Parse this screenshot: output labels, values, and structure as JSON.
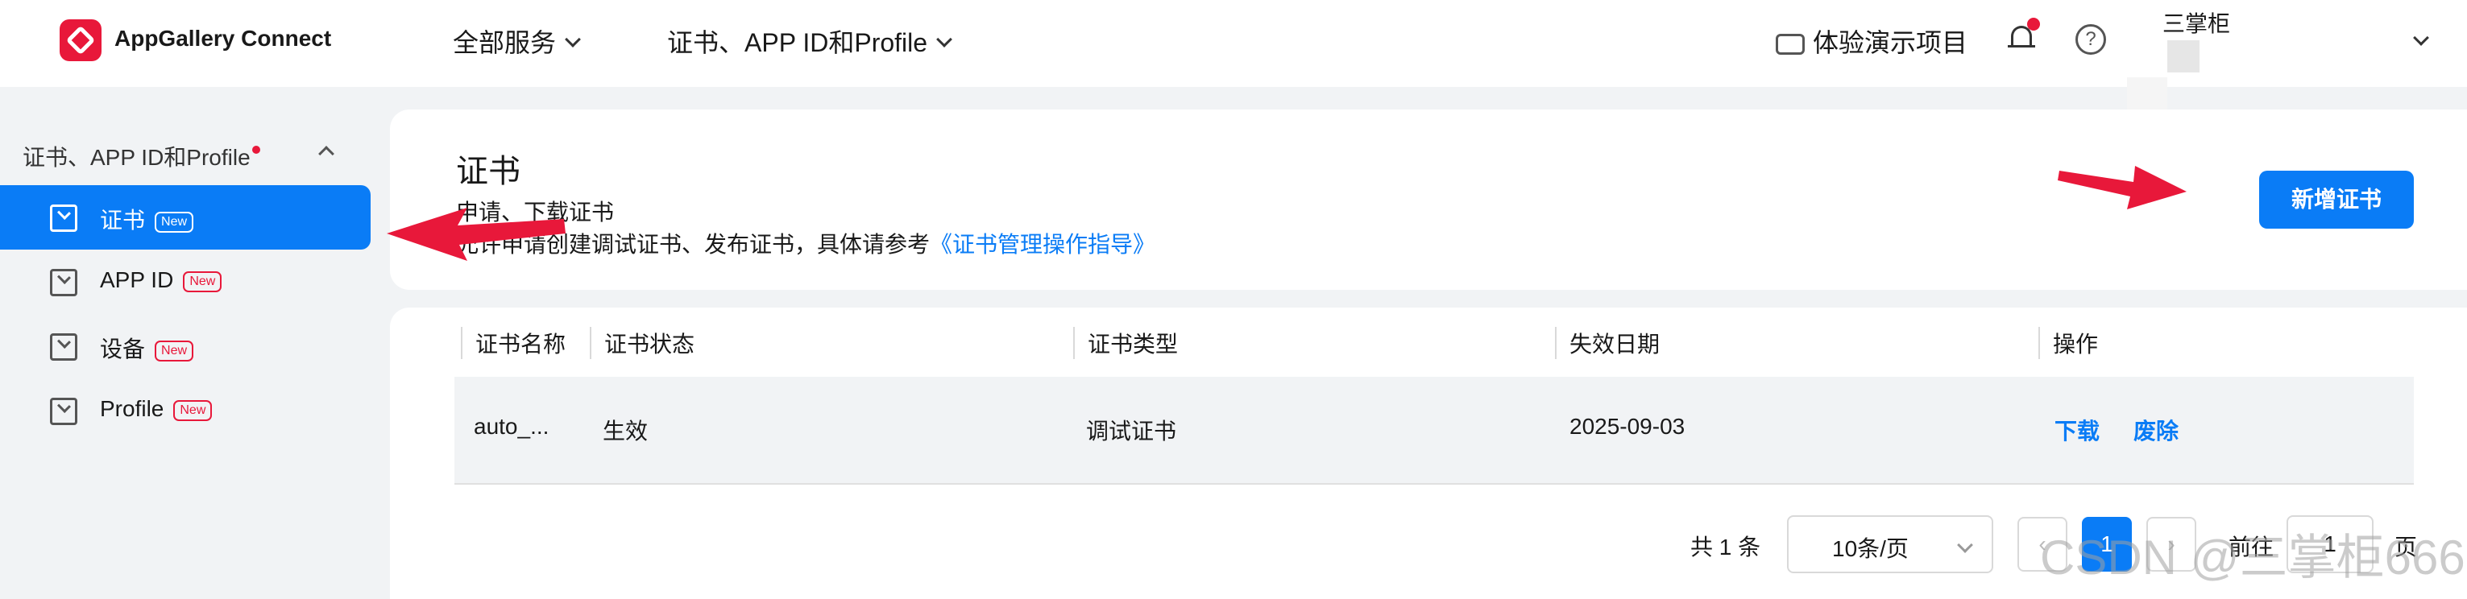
{
  "topbar": {
    "app_name": "AppGallery Connect",
    "nav": [
      "全部服务",
      "证书、APP ID和Profile"
    ],
    "demo_label": "体验演示项目",
    "help_glyph": "?",
    "username": "三掌柜"
  },
  "sidebar": {
    "group_label": "证书、APP ID和Profile",
    "items": [
      {
        "label": "证书",
        "badge": "New"
      },
      {
        "label": "APP ID",
        "badge": "New"
      },
      {
        "label": "设备",
        "badge": "New"
      },
      {
        "label": "Profile",
        "badge": "New"
      }
    ]
  },
  "header": {
    "title": "证书",
    "subtitle": "申请、下载证书",
    "description": "允许申请创建调试证书、发布证书，具体请参考",
    "guide_link": "《证书管理操作指导》",
    "add_button": "新增证书"
  },
  "table": {
    "columns": [
      "证书名称",
      "证书状态",
      "证书类型",
      "失效日期",
      "操作"
    ],
    "rows": [
      {
        "name": "auto_...",
        "status": "生效",
        "type": "调试证书",
        "expiry": "2025-09-03",
        "actions": [
          "下载",
          "废除"
        ]
      }
    ]
  },
  "pagination": {
    "total": "共 1 条",
    "page_size": "10条/页",
    "prev": "‹",
    "current": "1",
    "next": "›",
    "goto_label": "前往",
    "goto_value": "1",
    "page_word": "页"
  },
  "watermark": "CSDN @三掌柜666",
  "colors": {
    "accent": "#0a7cf6",
    "brand": "#e8183a",
    "annotation": "#e8183a"
  }
}
